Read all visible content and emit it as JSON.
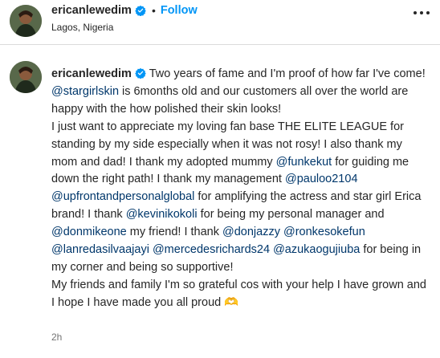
{
  "header": {
    "username": "ericanlewedim",
    "separator": "•",
    "follow_label": "Follow",
    "location": "Lagos, Nigeria",
    "more_icon": "more-horizontal-icon",
    "verified_icon": "verified-badge-icon"
  },
  "caption": {
    "username": "ericanlewedim",
    "line1": " Two years of fame and I'm proof of how far I've come!",
    "mention_stargirlskin": "@stargirlskin",
    "line2": " is 6months old and our customers all over the world are happy with the how polished their skin looks!",
    "line3": "I just want to appreciate my loving fan base THE ELITE LEAGUE for standing by my side especially when it was not rosy! I also thank my mom and dad! I thank my adopted mummy ",
    "mention_funkekut": "@funkekut",
    "line4": " for guiding me down the right path! I thank my management ",
    "mention_pauloo2104": "@pauloo2104",
    "space1": " ",
    "mention_upfront": "@upfrontandpersonalglobal",
    "line5": " for amplifying the actress and star girl Erica brand! I thank ",
    "mention_kevinikokoli": "@kevinikokoli",
    "line6": " for being my personal manager and ",
    "mention_donmikeone": "@donmikeone",
    "line7": " my friend! I thank ",
    "mention_donjazzy": "@donjazzy",
    "space2": " ",
    "mention_ronkesokefun": "@ronkesokefun",
    "space3": " ",
    "mention_lanredasilvaajayi": "@lanredasilvaajayi",
    "space4": " ",
    "mention_mercedesrichards24": "@mercedesrichards24",
    "space5": " ",
    "mention_azukaogujiuba": "@azukaogujiuba",
    "line8": " for being in my corner and being so supportive!",
    "line9": "My friends and family I'm so grateful cos with your help I have grown and I hope I have made you all proud 🫶",
    "timestamp": "2h"
  },
  "colors": {
    "text": "#262626",
    "link": "#00376b",
    "follow": "#0095f6",
    "verified": "#0095f6",
    "muted": "#737373",
    "divider": "#dbdbdb"
  }
}
